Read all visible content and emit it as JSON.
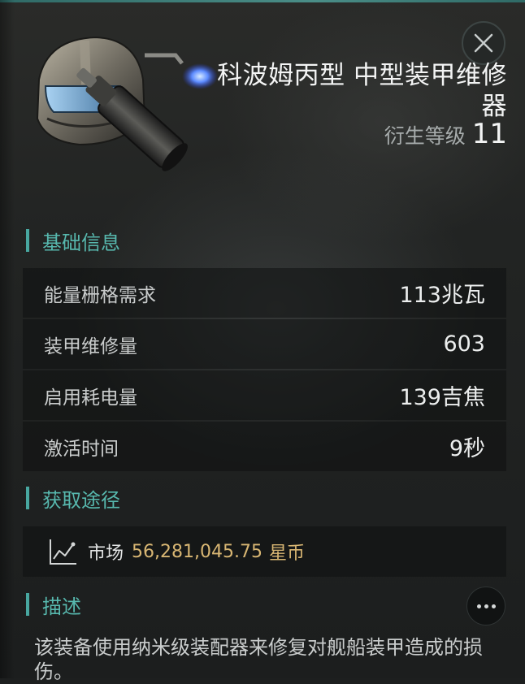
{
  "item": {
    "title": "科波姆丙型 中型装甲维修器",
    "meta_label": "衍生等级",
    "meta_value": "11",
    "icon": "armor-repairer-module-icon"
  },
  "header": {
    "close_icon": "close-icon"
  },
  "sections": {
    "basic": {
      "title": "基础信息"
    },
    "source": {
      "title": "获取途径"
    },
    "description": {
      "title": "描述"
    }
  },
  "attributes": [
    {
      "label": "能量栅格需求",
      "value": "113兆瓦"
    },
    {
      "label": "装甲维修量",
      "value": "603"
    },
    {
      "label": "启用耗电量",
      "value": "139吉焦"
    },
    {
      "label": "激活时间",
      "value": "9秒"
    }
  ],
  "market": {
    "icon": "trend-chart-icon",
    "label": "市场",
    "price": "56,281,045.75",
    "currency": "星币",
    "price_color": "#d8b673"
  },
  "description": {
    "text": "该装备使用纳米级装配器来修复对舰船装甲造成的损伤。"
  },
  "more_button": {
    "icon": "more-options-icon"
  },
  "colors": {
    "accent": "#48a7a0",
    "section_text": "#57b8ae"
  }
}
